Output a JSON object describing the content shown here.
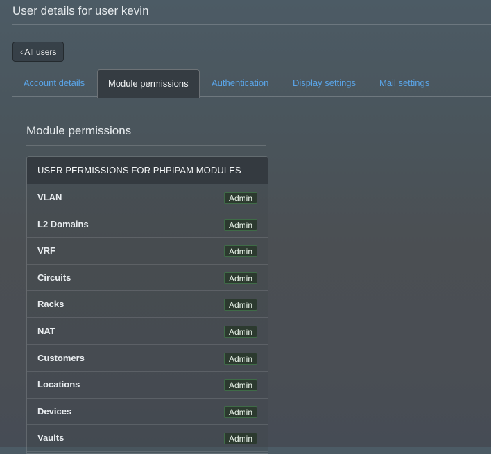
{
  "header": {
    "title": "User details for user kevin"
  },
  "back_button": {
    "chevron": "‹",
    "label": "All users"
  },
  "tabs": [
    {
      "label": "Account details",
      "active": false
    },
    {
      "label": "Module permissions",
      "active": true
    },
    {
      "label": "Authentication",
      "active": false
    },
    {
      "label": "Display settings",
      "active": false
    },
    {
      "label": "Mail settings",
      "active": false
    }
  ],
  "section": {
    "title": "Module permissions"
  },
  "panel": {
    "heading": "USER PERMISSIONS FOR PHPIPAM MODULES",
    "rows": [
      {
        "module": "VLAN",
        "permission": "Admin"
      },
      {
        "module": "L2 Domains",
        "permission": "Admin"
      },
      {
        "module": "VRF",
        "permission": "Admin"
      },
      {
        "module": "Circuits",
        "permission": "Admin"
      },
      {
        "module": "Racks",
        "permission": "Admin"
      },
      {
        "module": "NAT",
        "permission": "Admin"
      },
      {
        "module": "Customers",
        "permission": "Admin"
      },
      {
        "module": "Locations",
        "permission": "Admin"
      },
      {
        "module": "Devices",
        "permission": "Admin"
      },
      {
        "module": "Vaults",
        "permission": "Admin"
      }
    ]
  },
  "colors": {
    "link": "#5aa5e8",
    "badge_border": "#3f6b47",
    "panel_header": "#343a40"
  }
}
